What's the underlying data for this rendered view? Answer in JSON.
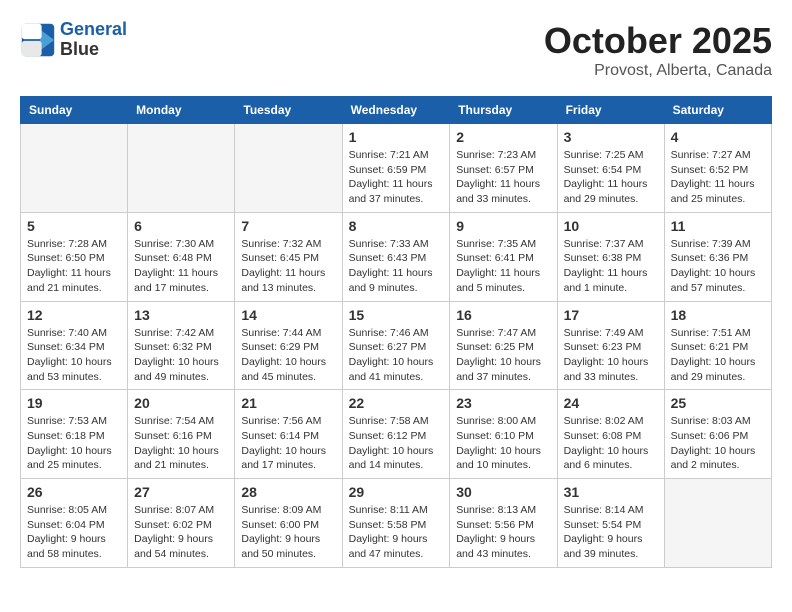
{
  "header": {
    "logo_line1": "General",
    "logo_line2": "Blue",
    "month": "October 2025",
    "location": "Provost, Alberta, Canada"
  },
  "weekdays": [
    "Sunday",
    "Monday",
    "Tuesday",
    "Wednesday",
    "Thursday",
    "Friday",
    "Saturday"
  ],
  "weeks": [
    [
      {
        "day": "",
        "empty": true
      },
      {
        "day": "",
        "empty": true
      },
      {
        "day": "",
        "empty": true
      },
      {
        "day": "1",
        "sunrise": "7:21 AM",
        "sunset": "6:59 PM",
        "daylight": "11 hours and 37 minutes."
      },
      {
        "day": "2",
        "sunrise": "7:23 AM",
        "sunset": "6:57 PM",
        "daylight": "11 hours and 33 minutes."
      },
      {
        "day": "3",
        "sunrise": "7:25 AM",
        "sunset": "6:54 PM",
        "daylight": "11 hours and 29 minutes."
      },
      {
        "day": "4",
        "sunrise": "7:27 AM",
        "sunset": "6:52 PM",
        "daylight": "11 hours and 25 minutes."
      }
    ],
    [
      {
        "day": "5",
        "sunrise": "7:28 AM",
        "sunset": "6:50 PM",
        "daylight": "11 hours and 21 minutes."
      },
      {
        "day": "6",
        "sunrise": "7:30 AM",
        "sunset": "6:48 PM",
        "daylight": "11 hours and 17 minutes."
      },
      {
        "day": "7",
        "sunrise": "7:32 AM",
        "sunset": "6:45 PM",
        "daylight": "11 hours and 13 minutes."
      },
      {
        "day": "8",
        "sunrise": "7:33 AM",
        "sunset": "6:43 PM",
        "daylight": "11 hours and 9 minutes."
      },
      {
        "day": "9",
        "sunrise": "7:35 AM",
        "sunset": "6:41 PM",
        "daylight": "11 hours and 5 minutes."
      },
      {
        "day": "10",
        "sunrise": "7:37 AM",
        "sunset": "6:38 PM",
        "daylight": "11 hours and 1 minute."
      },
      {
        "day": "11",
        "sunrise": "7:39 AM",
        "sunset": "6:36 PM",
        "daylight": "10 hours and 57 minutes."
      }
    ],
    [
      {
        "day": "12",
        "sunrise": "7:40 AM",
        "sunset": "6:34 PM",
        "daylight": "10 hours and 53 minutes."
      },
      {
        "day": "13",
        "sunrise": "7:42 AM",
        "sunset": "6:32 PM",
        "daylight": "10 hours and 49 minutes."
      },
      {
        "day": "14",
        "sunrise": "7:44 AM",
        "sunset": "6:29 PM",
        "daylight": "10 hours and 45 minutes."
      },
      {
        "day": "15",
        "sunrise": "7:46 AM",
        "sunset": "6:27 PM",
        "daylight": "10 hours and 41 minutes."
      },
      {
        "day": "16",
        "sunrise": "7:47 AM",
        "sunset": "6:25 PM",
        "daylight": "10 hours and 37 minutes."
      },
      {
        "day": "17",
        "sunrise": "7:49 AM",
        "sunset": "6:23 PM",
        "daylight": "10 hours and 33 minutes."
      },
      {
        "day": "18",
        "sunrise": "7:51 AM",
        "sunset": "6:21 PM",
        "daylight": "10 hours and 29 minutes."
      }
    ],
    [
      {
        "day": "19",
        "sunrise": "7:53 AM",
        "sunset": "6:18 PM",
        "daylight": "10 hours and 25 minutes."
      },
      {
        "day": "20",
        "sunrise": "7:54 AM",
        "sunset": "6:16 PM",
        "daylight": "10 hours and 21 minutes."
      },
      {
        "day": "21",
        "sunrise": "7:56 AM",
        "sunset": "6:14 PM",
        "daylight": "10 hours and 17 minutes."
      },
      {
        "day": "22",
        "sunrise": "7:58 AM",
        "sunset": "6:12 PM",
        "daylight": "10 hours and 14 minutes."
      },
      {
        "day": "23",
        "sunrise": "8:00 AM",
        "sunset": "6:10 PM",
        "daylight": "10 hours and 10 minutes."
      },
      {
        "day": "24",
        "sunrise": "8:02 AM",
        "sunset": "6:08 PM",
        "daylight": "10 hours and 6 minutes."
      },
      {
        "day": "25",
        "sunrise": "8:03 AM",
        "sunset": "6:06 PM",
        "daylight": "10 hours and 2 minutes."
      }
    ],
    [
      {
        "day": "26",
        "sunrise": "8:05 AM",
        "sunset": "6:04 PM",
        "daylight": "9 hours and 58 minutes."
      },
      {
        "day": "27",
        "sunrise": "8:07 AM",
        "sunset": "6:02 PM",
        "daylight": "9 hours and 54 minutes."
      },
      {
        "day": "28",
        "sunrise": "8:09 AM",
        "sunset": "6:00 PM",
        "daylight": "9 hours and 50 minutes."
      },
      {
        "day": "29",
        "sunrise": "8:11 AM",
        "sunset": "5:58 PM",
        "daylight": "9 hours and 47 minutes."
      },
      {
        "day": "30",
        "sunrise": "8:13 AM",
        "sunset": "5:56 PM",
        "daylight": "9 hours and 43 minutes."
      },
      {
        "day": "31",
        "sunrise": "8:14 AM",
        "sunset": "5:54 PM",
        "daylight": "9 hours and 39 minutes."
      },
      {
        "day": "",
        "empty": true
      }
    ]
  ]
}
